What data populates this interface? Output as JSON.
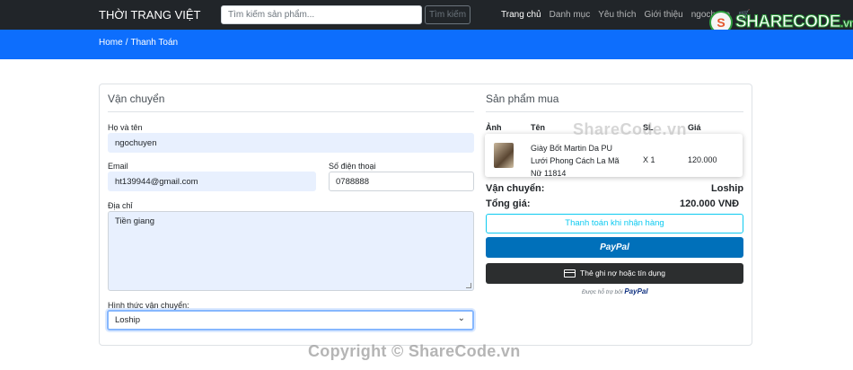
{
  "navbar": {
    "brand": "THỜI TRANG VIỆT",
    "search_placeholder": "Tìm kiếm sản phẩm...",
    "search_button": "Tìm kiếm",
    "links": [
      "Trang chủ",
      "Danh mục",
      "Yêu thích",
      "Giới thiệu",
      "ngochuye"
    ],
    "active_link": "Trang chủ"
  },
  "logo": {
    "badge": "S",
    "text": "SHARECODE",
    "suffix": ".vn"
  },
  "breadcrumb": {
    "home": "Home",
    "separator": "/",
    "current": "Thanh Toán"
  },
  "shipping": {
    "title": "Vận chuyển",
    "name_label": "Họ và tên",
    "name_value": "ngochuyen",
    "email_label": "Email",
    "email_value": "ht139944@gmail.com",
    "phone_label": "Số điện thoại",
    "phone_value": "0788888",
    "address_label": "Địa chỉ",
    "address_value": "Tiền giang",
    "method_label": "Hình thức vận chuyển:",
    "method_value": "Loship"
  },
  "products": {
    "title": "Sản phẩm mua",
    "headers": {
      "image": "Ảnh",
      "name": "Tên",
      "qty": "SL",
      "price": "Giá"
    },
    "items": [
      {
        "name": "Giày Bốt Martin Da PU Lưới Phong Cách La Mã Nữ 11814",
        "qty": "X 1",
        "price": "120.000"
      }
    ],
    "shipping_label": "Vận chuyển:",
    "shipping_value": "Loship",
    "total_label": "Tổng giá:",
    "total_value": "120.000 VNĐ"
  },
  "payment": {
    "cod_button": "Thanh toán khi nhận hàng",
    "paypal_button": "PayPal",
    "card_button": "Thẻ ghi nợ hoặc tín dụng",
    "powered_by": "Được hỗ trợ bởi",
    "powered_brand": "PayPal"
  },
  "watermarks": {
    "center": "ShareCode.vn",
    "footer": "Copyright © ShareCode.vn"
  },
  "colors": {
    "navbar": "#212529",
    "hero": "#0d6efd",
    "paypal": "#0070ba",
    "cod": "#0dcaf0"
  }
}
